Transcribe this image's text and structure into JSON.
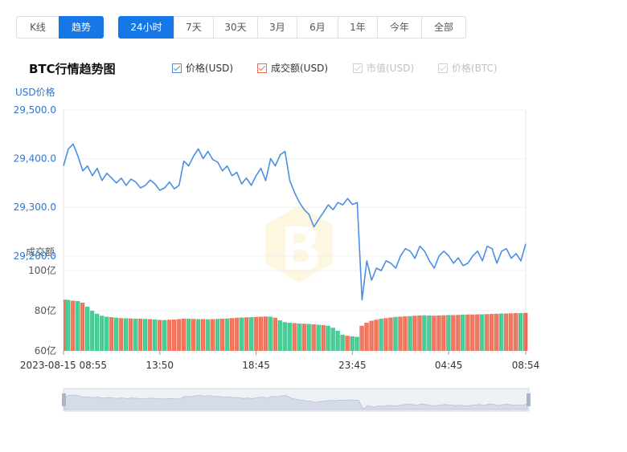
{
  "view_tabs": [
    {
      "label": "K线",
      "active": false
    },
    {
      "label": "趋势",
      "active": true
    }
  ],
  "range_tabs": [
    {
      "label": "24小时",
      "active": true
    },
    {
      "label": "7天",
      "active": false
    },
    {
      "label": "30天",
      "active": false
    },
    {
      "label": "3月",
      "active": false
    },
    {
      "label": "6月",
      "active": false
    },
    {
      "label": "1年",
      "active": false
    },
    {
      "label": "今年",
      "active": false
    },
    {
      "label": "全部",
      "active": false
    }
  ],
  "title": "BTC行情趋势图",
  "legend": [
    {
      "label": "价格(USD)",
      "color": "#4a90e2",
      "checked": true,
      "enabled": true
    },
    {
      "label": "成交额(USD)",
      "color": "#ef6a50",
      "checked": true,
      "enabled": true
    },
    {
      "label": "市值(USD)",
      "color": "#c8c8c8",
      "checked": true,
      "enabled": false
    },
    {
      "label": "价格(BTC)",
      "color": "#c8c8c8",
      "checked": true,
      "enabled": false
    }
  ],
  "colors": {
    "price_line": "#4a90e2",
    "axis_text": "#2f77d1",
    "up_bar": "#ef6a50",
    "down_bar": "#3cc48c",
    "grid": "#eeeeee",
    "slider_fill": "#d5dbe8"
  },
  "chart_data": {
    "type": "line",
    "price": {
      "ylabel": "USD价格",
      "ylim": [
        29170,
        29500
      ],
      "yticks": [
        "29,500.0",
        "29,400.0",
        "29,300.0",
        "29,200.0"
      ],
      "ytick_values": [
        29500,
        29400,
        29300,
        29200
      ],
      "x": [
        0,
        1,
        2,
        3,
        4,
        5,
        6,
        7,
        8,
        9,
        10,
        11,
        12,
        13,
        14,
        15,
        16,
        17,
        18,
        19,
        20,
        21,
        22,
        23,
        24,
        25,
        26,
        27,
        28,
        29,
        30,
        31,
        32,
        33,
        34,
        35,
        36,
        37,
        38,
        39,
        40,
        41,
        42,
        43,
        44,
        45,
        46,
        47,
        48,
        49,
        50,
        51,
        52,
        53,
        54,
        55,
        56,
        57,
        58,
        59,
        60,
        61,
        62,
        63,
        64,
        65,
        66,
        67,
        68,
        69,
        70,
        71,
        72,
        73,
        74,
        75,
        76,
        77,
        78,
        79,
        80,
        81,
        82,
        83,
        84,
        85,
        86,
        87,
        88,
        89,
        90,
        91,
        92,
        93,
        94,
        95,
        96
      ],
      "values": [
        29385,
        29420,
        29430,
        29405,
        29375,
        29385,
        29365,
        29380,
        29355,
        29370,
        29360,
        29350,
        29360,
        29345,
        29358,
        29352,
        29340,
        29345,
        29356,
        29348,
        29335,
        29340,
        29352,
        29338,
        29345,
        29395,
        29385,
        29405,
        29420,
        29400,
        29415,
        29398,
        29393,
        29375,
        29385,
        29365,
        29372,
        29348,
        29360,
        29345,
        29365,
        29380,
        29355,
        29400,
        29385,
        29408,
        29415,
        29355,
        29330,
        29310,
        29295,
        29285,
        29260,
        29275,
        29290,
        29305,
        29295,
        29310,
        29305,
        29318,
        29306,
        29310,
        29110,
        29190,
        29150,
        29175,
        29170,
        29190,
        29185,
        29175,
        29200,
        29215,
        29210,
        29195,
        29220,
        29210,
        29190,
        29175,
        29200,
        29210,
        29200,
        29185,
        29196,
        29180,
        29185,
        29200,
        29210,
        29190,
        29220,
        29215,
        29185,
        29210,
        29215,
        29195,
        29205,
        29190,
        29225
      ]
    },
    "volume": {
      "ylabel": "成交额",
      "ylim": [
        60,
        100
      ],
      "yticks": [
        "100亿",
        "80亿",
        "60亿"
      ],
      "ytick_values": [
        100,
        80,
        60
      ],
      "x": [
        0,
        1,
        2,
        3,
        4,
        5,
        6,
        7,
        8,
        9,
        10,
        11,
        12,
        13,
        14,
        15,
        16,
        17,
        18,
        19,
        20,
        21,
        22,
        23,
        24,
        25,
        26,
        27,
        28,
        29,
        30,
        31,
        32,
        33,
        34,
        35,
        36,
        37,
        38,
        39,
        40,
        41,
        42,
        43,
        44,
        45,
        46,
        47,
        48,
        49,
        50,
        51,
        52,
        53,
        54,
        55,
        56,
        57,
        58,
        59,
        60,
        61,
        62,
        63,
        64,
        65,
        66,
        67,
        68,
        69,
        70,
        71,
        72,
        73,
        74,
        75,
        76,
        77,
        78,
        79,
        80,
        81,
        82,
        83,
        84,
        85,
        86,
        87,
        88,
        89,
        90,
        91,
        92,
        93,
        94,
        95,
        96
      ],
      "values": [
        85.5,
        85.3,
        85,
        84.8,
        84,
        82,
        80,
        78.5,
        77.5,
        77,
        76.8,
        76.5,
        76.3,
        76.2,
        76.1,
        76,
        76,
        75.9,
        75.8,
        75.6,
        75.4,
        75.3,
        75.5,
        75.6,
        75.8,
        76,
        76,
        75.9,
        75.8,
        75.8,
        75.7,
        75.8,
        75.9,
        76,
        76.1,
        76.3,
        76.5,
        76.6,
        76.7,
        76.8,
        76.9,
        77,
        77.1,
        77,
        76.5,
        75.2,
        74.3,
        74,
        73.8,
        73.6,
        73.5,
        73.4,
        73.2,
        73,
        72.8,
        72.5,
        71.5,
        70,
        68,
        67.5,
        67.2,
        67,
        72.5,
        74,
        75,
        75.5,
        76,
        76.3,
        76.6,
        76.9,
        77,
        77.2,
        77.3,
        77.5,
        77.6,
        77.7,
        77.6,
        77.5,
        77.6,
        77.7,
        77.8,
        77.8,
        77.9,
        78,
        78.1,
        78.1,
        78.2,
        78.2,
        78.3,
        78.4,
        78.5,
        78.6,
        78.6,
        78.7,
        78.8,
        78.8,
        78.9
      ],
      "up": [
        true,
        false,
        true,
        false,
        true,
        false,
        false,
        false,
        false,
        false,
        true,
        false,
        true,
        false,
        true,
        false,
        true,
        false,
        true,
        false,
        true,
        false,
        true,
        true,
        true,
        true,
        false,
        true,
        false,
        true,
        false,
        true,
        false,
        true,
        false,
        true,
        true,
        false,
        true,
        false,
        true,
        true,
        true,
        false,
        true,
        false,
        false,
        false,
        true,
        false,
        true,
        false,
        true,
        false,
        true,
        false,
        false,
        false,
        false,
        true,
        false,
        false,
        true,
        true,
        true,
        true,
        false,
        true,
        true,
        false,
        true,
        true,
        false,
        true,
        true,
        false,
        false,
        true,
        true,
        true,
        false,
        true,
        true,
        false,
        true,
        true,
        true,
        false,
        true,
        true,
        true,
        false,
        true,
        true,
        true,
        false,
        true
      ]
    },
    "xticks": [
      "2023-08-15 08:55",
      "13:50",
      "18:45",
      "23:45",
      "04:45",
      "08:54"
    ],
    "xtick_positions": [
      0,
      20,
      40,
      60,
      80,
      96
    ]
  }
}
